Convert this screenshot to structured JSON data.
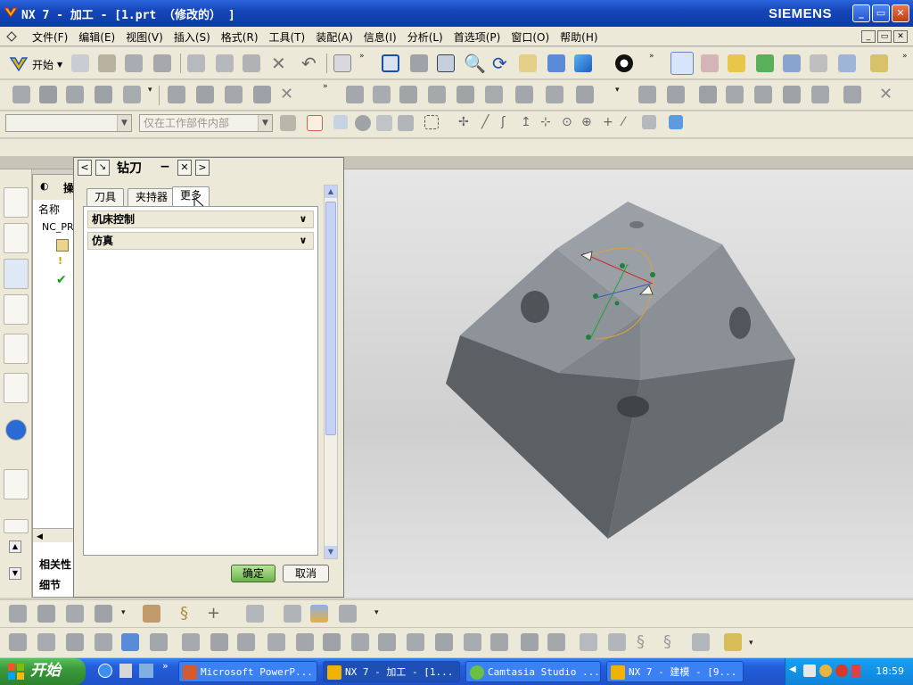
{
  "window": {
    "title": "NX 7 - 加工 - [1.prt （修改的）  ]",
    "brand": "SIEMENS",
    "controls": [
      "_",
      "▭",
      "✕"
    ]
  },
  "menubar": {
    "items": [
      "文件(F)",
      "编辑(E)",
      "视图(V)",
      "插入(S)",
      "格式(R)",
      "工具(T)",
      "装配(A)",
      "信息(I)",
      "分析(L)",
      "首选项(P)",
      "窗口(O)",
      "帮助(H)"
    ]
  },
  "toolbar": {
    "start_label": "开始"
  },
  "selection_bar": {
    "filter_value": "",
    "scope_value": "仅在工作部件内部"
  },
  "navigator": {
    "title": "操",
    "column_name": "名称",
    "root_item": "NC_PR",
    "related_label": "相关性",
    "detail_label": "细节"
  },
  "dialog": {
    "title": "钻刀",
    "tabs": [
      "刀具",
      "夹持器",
      "更多"
    ],
    "active_tab": 2,
    "groups": [
      "机床控制",
      "仿真"
    ],
    "ok_label": "确定",
    "cancel_label": "取消"
  },
  "taskbar": {
    "start_label": "开始",
    "tasks": [
      {
        "label": "Microsoft PowerP...",
        "active": false
      },
      {
        "label": "NX 7 - 加工 - [1...",
        "active": true
      },
      {
        "label": "Camtasia Studio ...",
        "active": false
      },
      {
        "label": "NX 7 - 建模 - [9...",
        "active": false
      }
    ],
    "clock": "18:59"
  },
  "colors": {
    "titlebar": "#1546b8",
    "taskbar": "#245edb",
    "part_top": "#8a9096",
    "part_side": "#5d6367",
    "part_light": "#9aa0a6",
    "ok_button": "#6cb24a"
  }
}
